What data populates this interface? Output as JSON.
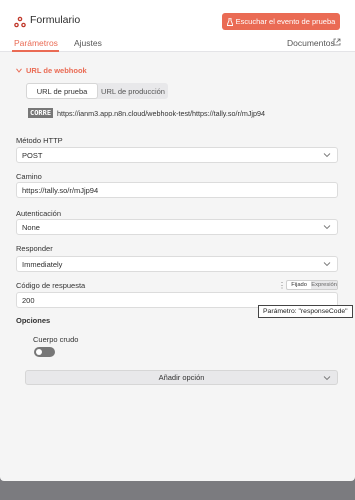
{
  "header": {
    "title": "Formulario",
    "listen_button": "Escuchar el evento de prueba",
    "logo_icon": "webhook-logo-icon",
    "accent_color": "#ea6b54"
  },
  "tabs": {
    "parameters": "Parámetros",
    "settings": "Ajustes",
    "docs": "Documentos"
  },
  "webhook": {
    "section_label": "URL de webhook",
    "test_url_tab": "URL de prueba",
    "production_url_tab": "URL de producción",
    "method_badge": "CORRE",
    "url": "https://ianm3.app.n8n.cloud/webhook-test/https://tally.so/r/mJjp94"
  },
  "fields": {
    "http_method": {
      "label": "Método HTTP",
      "value": "POST"
    },
    "path": {
      "label": "Camino",
      "value": "https://tally.so/r/mJjp94"
    },
    "authentication": {
      "label": "Autenticación",
      "value": "None"
    },
    "respond": {
      "label": "Responder",
      "value": "Immediately"
    },
    "response_code": {
      "label": "Código de respuesta",
      "value": "200",
      "fixed_label": "Fijado",
      "expression_label": "Expresión",
      "tooltip": "Parámetro: \"responseCode\""
    }
  },
  "options": {
    "title": "Opciones",
    "raw_body_label": "Cuerpo crudo",
    "raw_body_enabled": false,
    "add_option": "Añadir opción"
  }
}
